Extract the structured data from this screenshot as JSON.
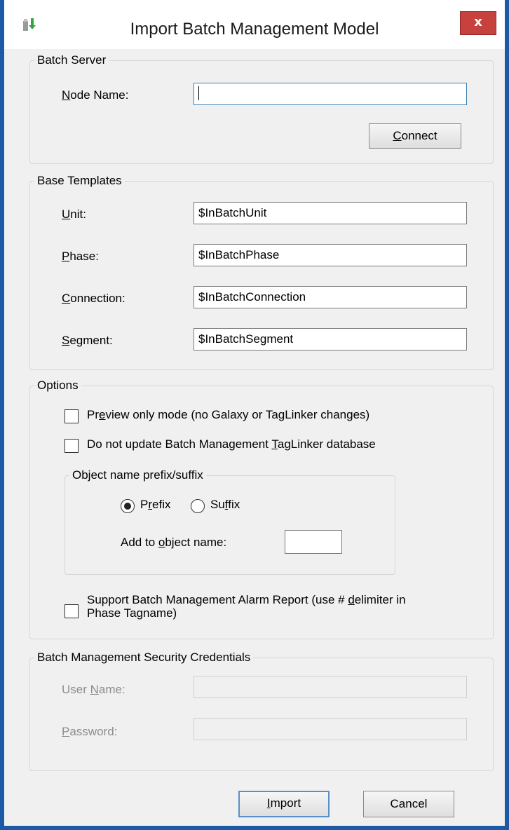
{
  "window": {
    "title": "Import Batch Management Model",
    "close_label": "x"
  },
  "batch_server": {
    "legend": "Batch Server",
    "node_name": {
      "pre": "",
      "key": "N",
      "post": "ode Name:",
      "value": ""
    },
    "connect": {
      "pre": "",
      "key": "C",
      "post": "onnect"
    }
  },
  "base_templates": {
    "legend": "Base Templates",
    "unit": {
      "pre": "",
      "key": "U",
      "post": "nit:",
      "value": "$InBatchUnit"
    },
    "phase": {
      "pre": "",
      "key": "P",
      "post": "hase:",
      "value": "$InBatchPhase"
    },
    "connection": {
      "pre": "",
      "key": "C",
      "post": "onnection:",
      "value": "$InBatchConnection"
    },
    "segment": {
      "pre": "",
      "key": "S",
      "post": "egment:",
      "value": "$InBatchSegment"
    }
  },
  "options": {
    "legend": "Options",
    "preview": {
      "pre": "Pr",
      "key": "e",
      "post": "view only mode (no Galaxy or TagLinker changes)",
      "checked": false
    },
    "no_update": {
      "pre": "Do not update Batch Management ",
      "key": "T",
      "post": "agLinker database",
      "checked": false
    },
    "prefix_suffix": {
      "legend": "Object name prefix/suffix",
      "prefix": {
        "pre": "P",
        "key": "r",
        "post": "efix",
        "checked": true
      },
      "suffix": {
        "pre": "Su",
        "key": "f",
        "post": "fix",
        "checked": false
      },
      "add_to_name": {
        "pre": "Add to ",
        "key": "o",
        "post": "bject name:",
        "value": ""
      }
    },
    "alarm_report": {
      "line1_pre": "Support Batch Management Alarm Report (use # ",
      "line1_key": "d",
      "line1_post": "elimiter in",
      "line2": "Phase Tagname)",
      "checked": false
    }
  },
  "security": {
    "legend": "Batch Management Security Credentials",
    "user_name": {
      "pre": "User ",
      "key": "N",
      "post": "ame:",
      "value": ""
    },
    "password": {
      "pre": "",
      "key": "P",
      "post": "assword:",
      "value": ""
    }
  },
  "footer": {
    "import": {
      "pre": "",
      "key": "I",
      "post": "mport"
    },
    "cancel": "Cancel"
  }
}
